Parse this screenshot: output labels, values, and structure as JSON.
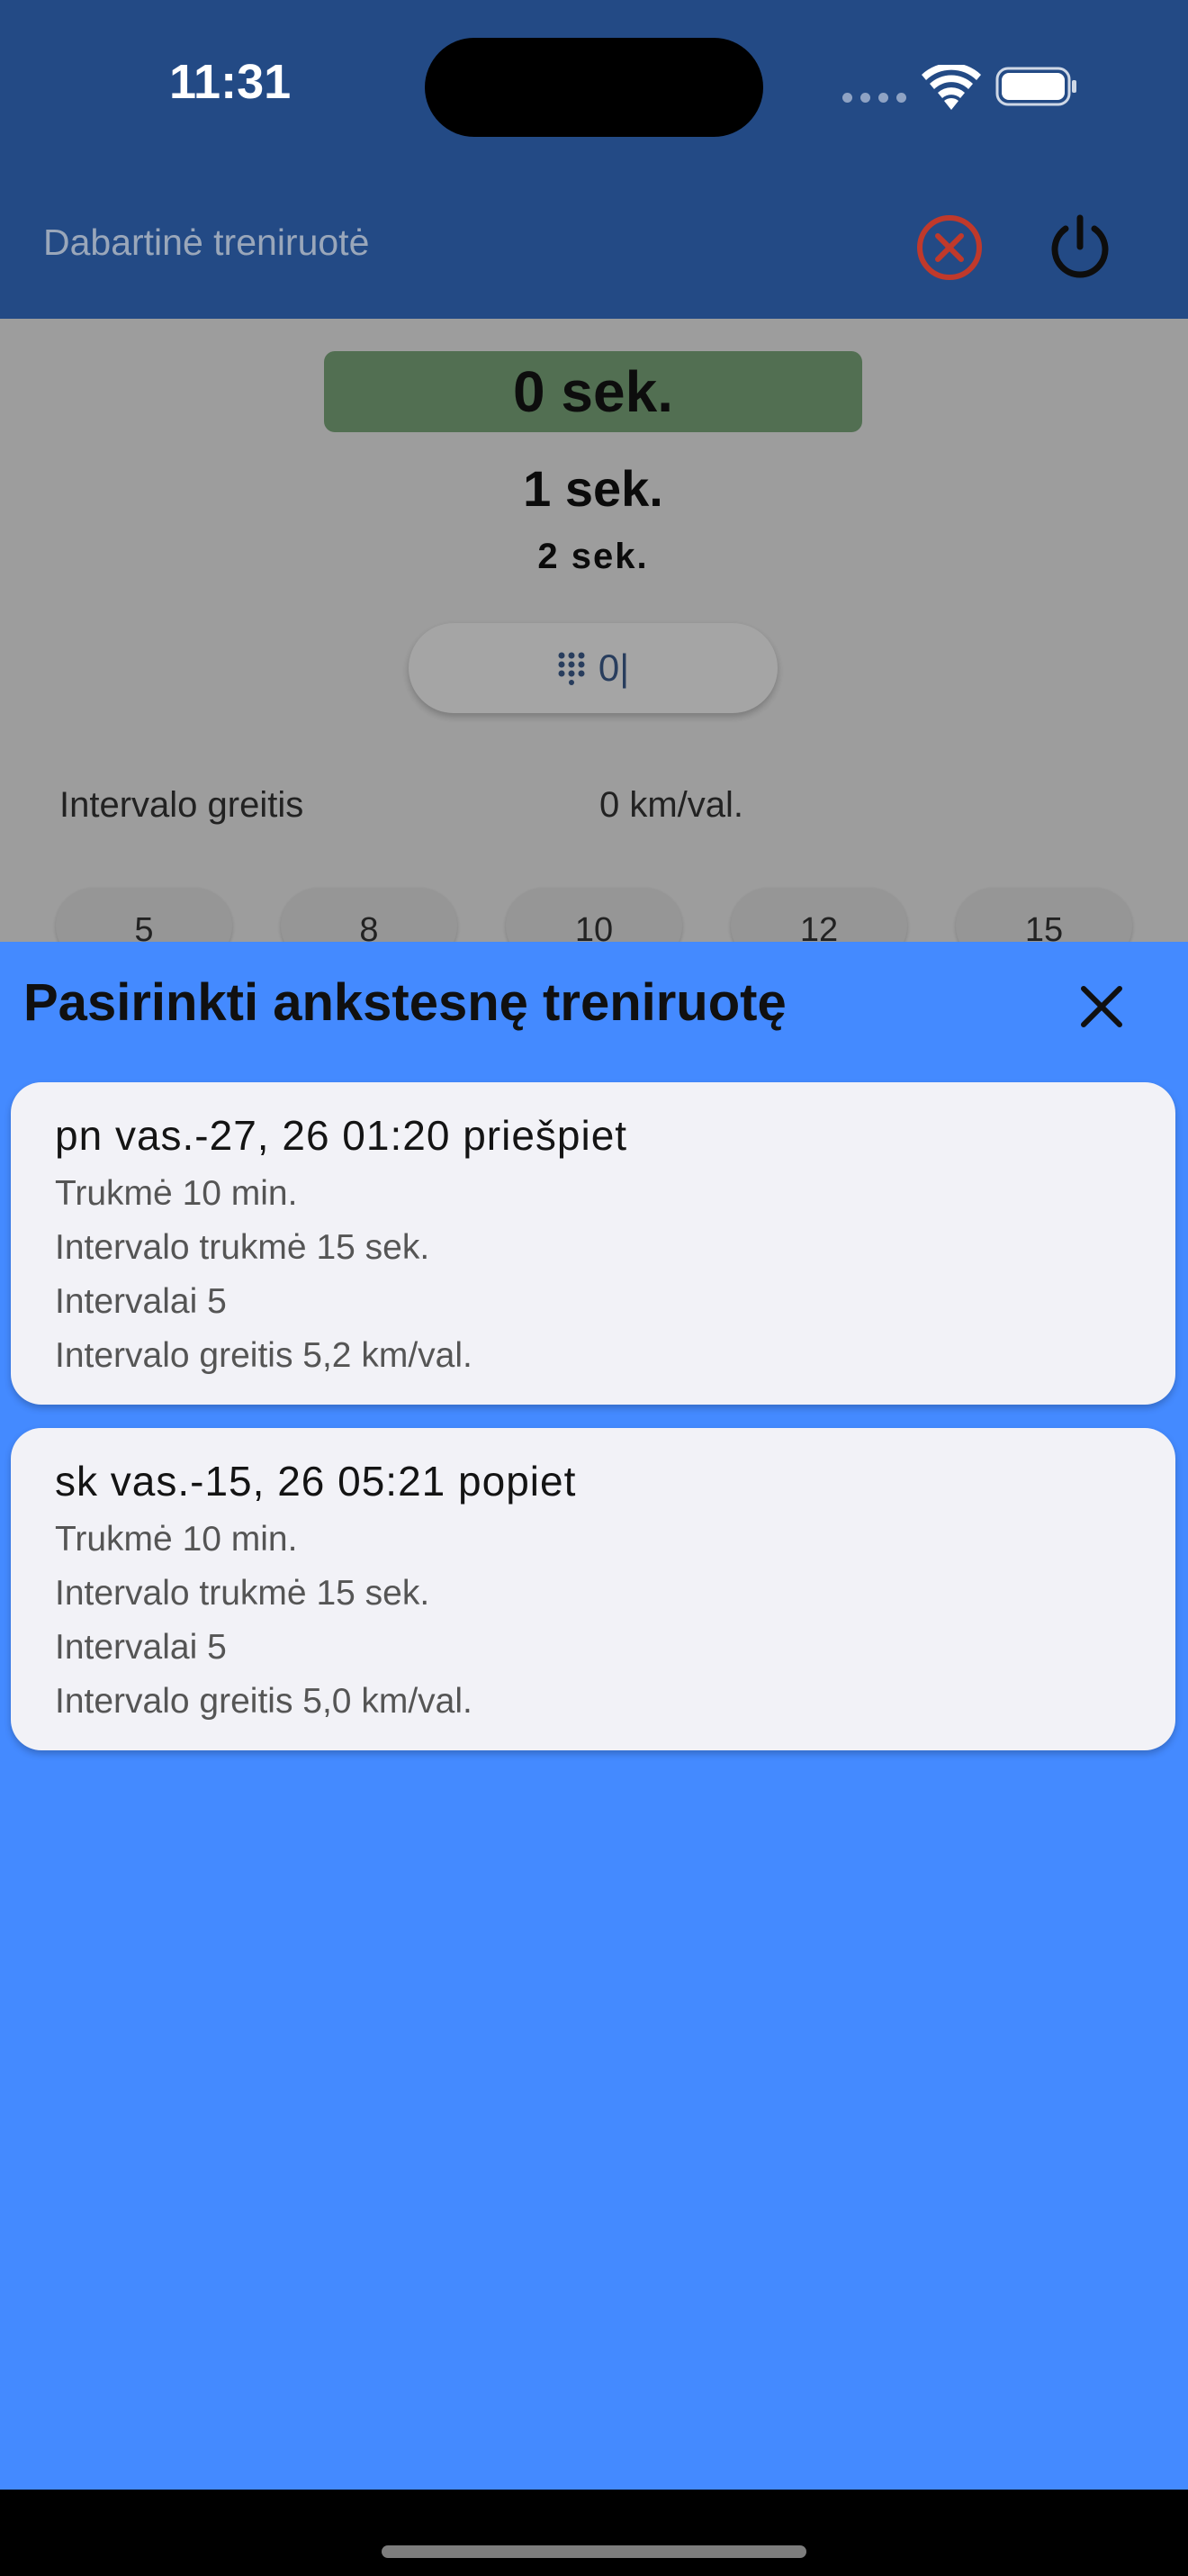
{
  "status_bar": {
    "time": "11:31",
    "icons": [
      "cellular-signal-icon",
      "wifi-icon",
      "battery-icon"
    ]
  },
  "app_bar": {
    "title": "Dabartinė treniruotė",
    "actions": [
      "cancel-circle-icon",
      "power-icon"
    ],
    "background": "#234a85"
  },
  "timers": {
    "current": "0 sek.",
    "next": "1 sek.",
    "after": "2 sek.",
    "current_bg": "#7aa47a"
  },
  "input": {
    "value": "0|",
    "icon": "dialpad-icon"
  },
  "speed": {
    "label": "Intervalo greitis",
    "value": "0 km/val.",
    "chips": [
      "5",
      "8",
      "10",
      "12",
      "15"
    ]
  },
  "sheet": {
    "title": "Pasirinkti ankstesnę treniruotę",
    "close_icon": "close-icon",
    "background": "#448aff",
    "cards": [
      {
        "title": "pn vas.-27, 26 01:20 priešpiet",
        "lines": [
          "Trukmė 10 min.",
          "Intervalo trukmė 15 sek.",
          "Intervalai 5",
          "Intervalo greitis 5,2 km/val."
        ]
      },
      {
        "title": "sk vas.-15, 26 05:21 popiet",
        "lines": [
          "Trukmė 10 min.",
          "Intervalo trukmė 15 sek.",
          "Intervalai 5",
          "Intervalo greitis 5,0 km/val."
        ]
      }
    ]
  }
}
